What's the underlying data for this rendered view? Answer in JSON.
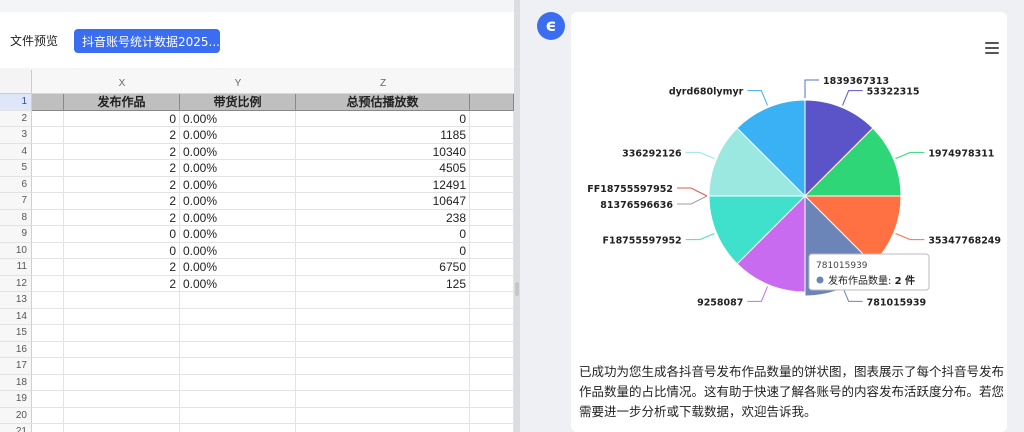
{
  "left_panel": {
    "preview_label": "文件预览",
    "file_tab": "抖音账号统计数据2025..."
  },
  "sheet": {
    "column_letters": [
      "X",
      "Y",
      "Z"
    ],
    "headers": [
      "发布作品",
      "带货比例",
      "总预估播放数"
    ],
    "rows": [
      {
        "n": "2",
        "x": "0",
        "y": "0.00%",
        "z": "0"
      },
      {
        "n": "3",
        "x": "2",
        "y": "0.00%",
        "z": "1185"
      },
      {
        "n": "4",
        "x": "2",
        "y": "0.00%",
        "z": "10340"
      },
      {
        "n": "5",
        "x": "2",
        "y": "0.00%",
        "z": "4505"
      },
      {
        "n": "6",
        "x": "2",
        "y": "0.00%",
        "z": "12491"
      },
      {
        "n": "7",
        "x": "2",
        "y": "0.00%",
        "z": "10647"
      },
      {
        "n": "8",
        "x": "2",
        "y": "0.00%",
        "z": "238"
      },
      {
        "n": "9",
        "x": "0",
        "y": "0.00%",
        "z": "0"
      },
      {
        "n": "10",
        "x": "0",
        "y": "0.00%",
        "z": "0"
      },
      {
        "n": "11",
        "x": "2",
        "y": "0.00%",
        "z": "6750"
      },
      {
        "n": "12",
        "x": "2",
        "y": "0.00%",
        "z": "125"
      }
    ],
    "empty_rows": [
      "13",
      "14",
      "15",
      "16",
      "17",
      "18",
      "19",
      "20",
      "21"
    ]
  },
  "right_panel": {
    "logo_letter": "ϵ",
    "menu_icon": "hamburger-icon",
    "description": "已成功为您生成各抖音号发布作品数量的饼状图，图表展示了每个抖音号发布作品数量的占比情况。这有助于快速了解各账号的内容发布活跃度分布。若您需要进一步分析或下载数据，欢迎告诉我。",
    "tooltip": {
      "title": "781015939",
      "label": "发布作品数量: ",
      "value": "2 件"
    }
  },
  "chart_data": {
    "type": "pie",
    "title": "",
    "series": [
      {
        "name": "发布作品数量",
        "slices": [
          {
            "label": "1839367313",
            "value": 0,
            "color": "#5470c6"
          },
          {
            "label": "53322315",
            "value": 2,
            "color": "#5b54c8"
          },
          {
            "label": "1974978311",
            "value": 2,
            "color": "#2fd678"
          },
          {
            "label": "35347768249",
            "value": 2,
            "color": "#ff7043"
          },
          {
            "label": "781015939",
            "value": 2,
            "color": "#6c85b8"
          },
          {
            "label": "9258087",
            "value": 2,
            "color": "#c86bf0"
          },
          {
            "label": "F18755597952",
            "value": 2,
            "color": "#3fe0cc"
          },
          {
            "label": "81376596636",
            "value": 0,
            "color": "#9e9e9e"
          },
          {
            "label": "FF18755597952",
            "value": 0,
            "color": "#e05555"
          },
          {
            "label": "336292126",
            "value": 2,
            "color": "#9be8e0"
          },
          {
            "label": "dyrd680lymyr",
            "value": 2,
            "color": "#3ab0f5"
          }
        ]
      }
    ],
    "highlighted": "781015939",
    "legend": "none"
  }
}
